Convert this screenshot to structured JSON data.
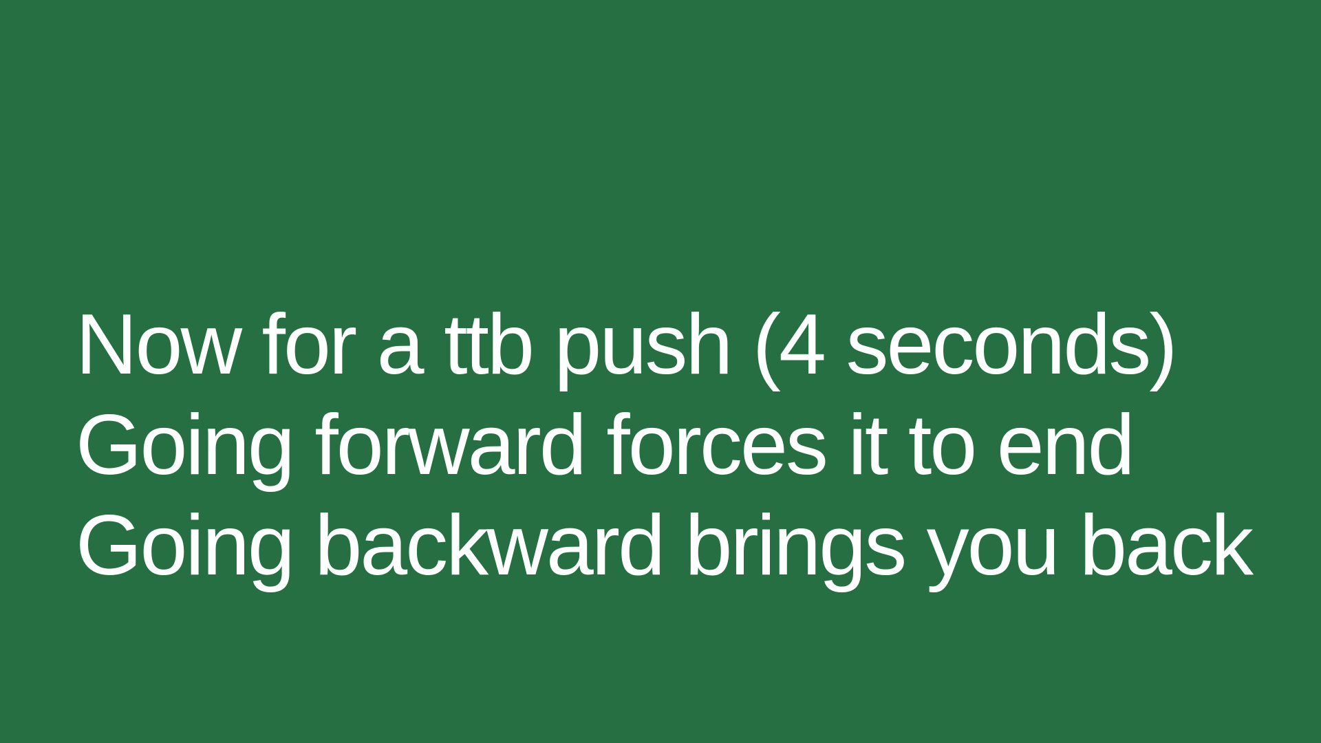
{
  "slide": {
    "background_color": "#256f43",
    "text_color": "#ffffff",
    "lines": [
      "Now for a ttb push (4 seconds)",
      "Going forward forces it to end",
      "Going backward brings you back"
    ]
  }
}
